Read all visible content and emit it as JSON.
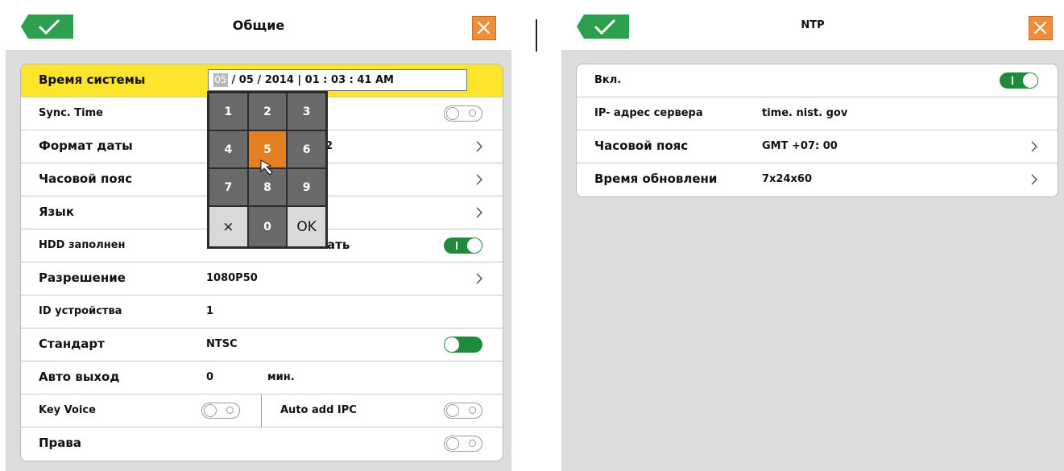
{
  "general": {
    "title": "Общие",
    "rows": {
      "system_time": {
        "label": "Время системы",
        "day_cursor": "05",
        "date_rest": "/ 05 / 2014 | 01 : 03 : 41 AM"
      },
      "sync_time": {
        "label": "Sync. Time"
      },
      "date_format": {
        "label": "Формат даты",
        "value_tail": "2"
      },
      "time_zone": {
        "label": "Часовой пояс"
      },
      "language": {
        "label": "Язык"
      },
      "hdd_full": {
        "label": "HDD заполнен",
        "value": "ать"
      },
      "resolution": {
        "label": "Разрешение",
        "value": "1080P50"
      },
      "device_id": {
        "label": "ID устройства",
        "value": "1"
      },
      "standard": {
        "label": "Стандарт",
        "value": "NTSC"
      },
      "auto_exit": {
        "label": "Авто выход",
        "value": "0",
        "unit": "мин."
      },
      "key_voice": {
        "label": "Key Voice"
      },
      "auto_add_ipc": {
        "label": "Auto add IPC"
      },
      "rights": {
        "label": "Права"
      }
    },
    "keypad": [
      "1",
      "2",
      "3",
      "4",
      "5",
      "6",
      "7",
      "8",
      "9",
      "×",
      "0",
      "OK"
    ]
  },
  "ntp": {
    "title": "NTP",
    "rows": {
      "enable": {
        "label": "Вкл."
      },
      "server": {
        "label": "IP- адрес сервера",
        "value": "time. nist. gov"
      },
      "time_zone": {
        "label": "Часовой пояс",
        "value": "GMT +07: 00"
      },
      "update_time": {
        "label": "Время обновлени",
        "value": "7x24x60"
      }
    }
  },
  "colors": {
    "highlight": "#fde52e",
    "accent": "#e67e22",
    "toggle_on": "#1e8a3c",
    "ok_green": "#2e9e4f"
  }
}
